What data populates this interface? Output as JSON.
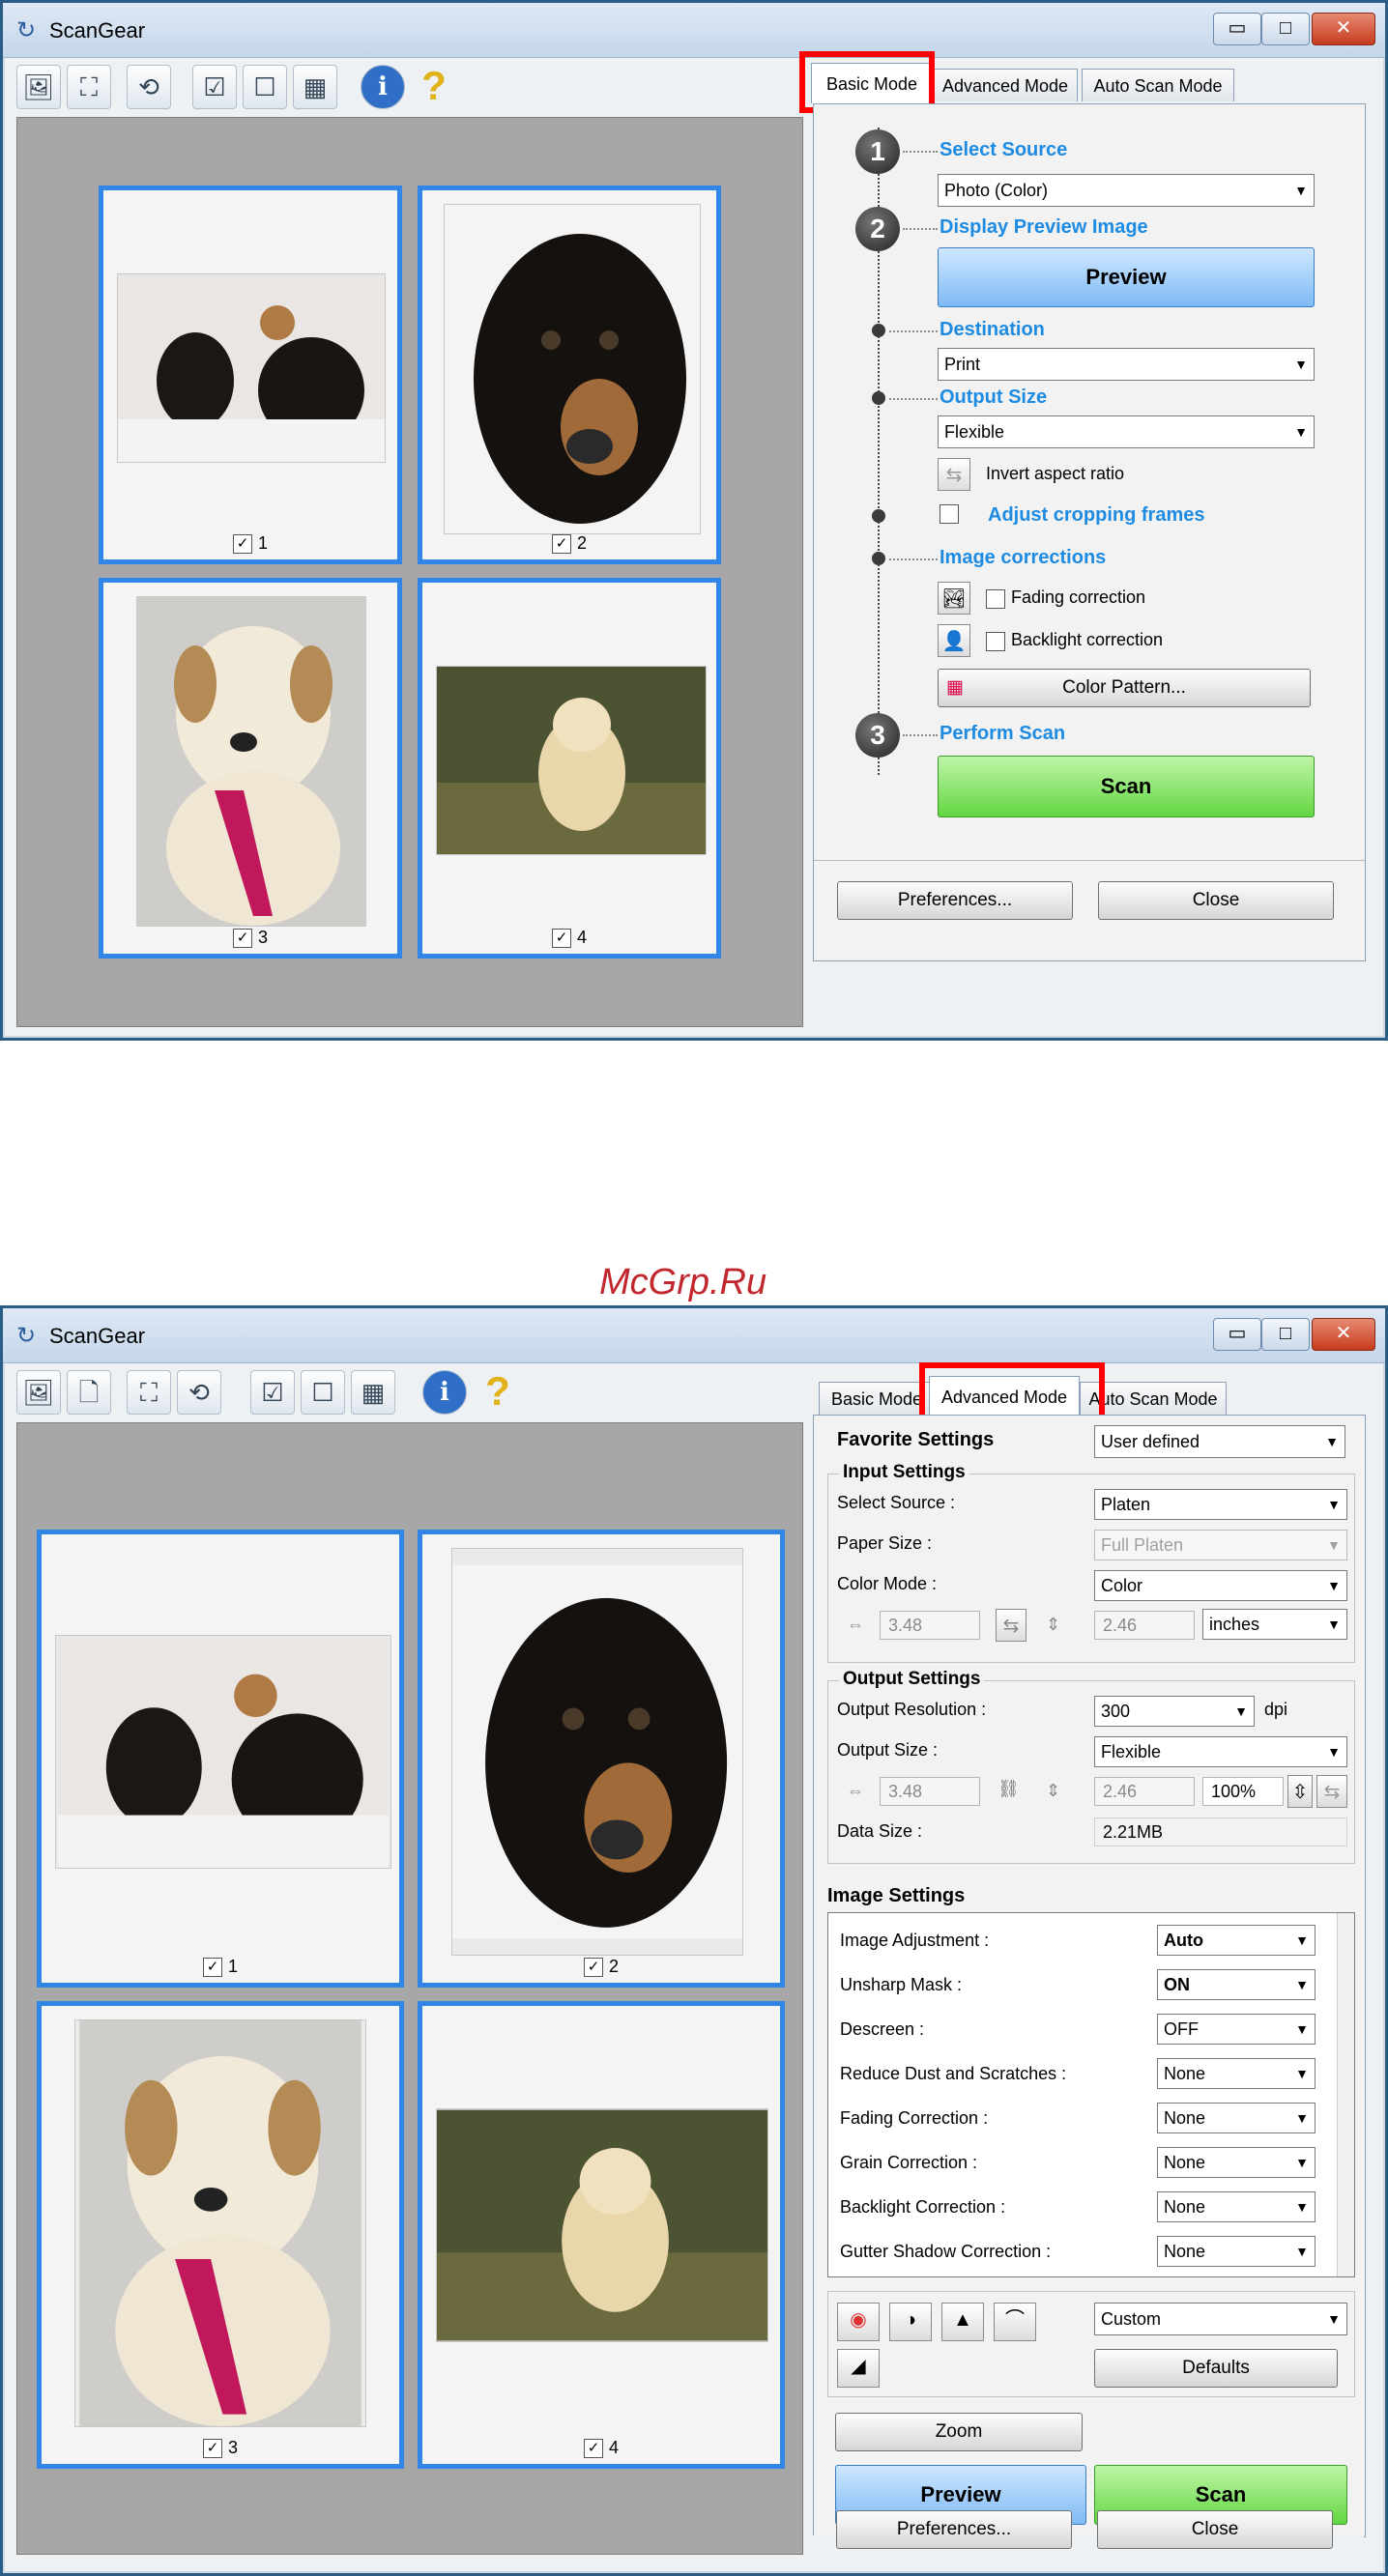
{
  "watermark": "McGrp.Ru",
  "window_title": "ScanGear",
  "window_controls": {
    "minimize": "▭",
    "maximize": "□",
    "close": "✕"
  },
  "toolbar_glyphs": {
    "info": "i",
    "help": "?"
  },
  "thumbnails": [
    {
      "number": "1",
      "checked": "✓"
    },
    {
      "number": "2",
      "checked": "✓"
    },
    {
      "number": "3",
      "checked": "✓"
    },
    {
      "number": "4",
      "checked": "✓"
    }
  ],
  "tabs": {
    "basic": "Basic Mode",
    "advanced": "Advanced Mode",
    "auto": "Auto Scan Mode"
  },
  "basic": {
    "steps": [
      "1",
      "2",
      "3"
    ],
    "select_source_label": "Select Source",
    "select_source_value": "Photo (Color)",
    "display_preview_label": "Display Preview Image",
    "preview_button": "Preview",
    "destination_label": "Destination",
    "destination_value": "Print",
    "output_size_label": "Output Size",
    "output_size_value": "Flexible",
    "invert_aspect_ratio": "Invert aspect ratio",
    "adjust_cropping": "Adjust cropping frames",
    "image_corrections_label": "Image corrections",
    "fading_correction": "Fading correction",
    "backlight_correction": "Backlight correction",
    "color_pattern_button": "Color Pattern...",
    "perform_scan_label": "Perform Scan",
    "scan_button": "Scan"
  },
  "advanced": {
    "favorite_settings_label": "Favorite Settings",
    "favorite_settings_value": "User defined",
    "input_settings_title": "Input Settings",
    "select_source_label": "Select Source :",
    "select_source_value": "Platen",
    "paper_size_label": "Paper Size :",
    "paper_size_value": "Full Platen",
    "color_mode_label": "Color Mode :",
    "color_mode_value": "Color",
    "input_width": "3.48",
    "input_height": "2.46",
    "units_value": "inches",
    "output_settings_title": "Output Settings",
    "output_resolution_label": "Output Resolution :",
    "output_resolution_value": "300",
    "dpi_label": "dpi",
    "output_size_label": "Output Size :",
    "output_size_value": "Flexible",
    "output_width": "3.48",
    "output_height": "2.46",
    "scale_value": "100%",
    "data_size_label": "Data Size :",
    "data_size_value": "2.21MB",
    "image_settings_title": "Image Settings",
    "image_settings": [
      {
        "label": "Image Adjustment :",
        "value": "Auto"
      },
      {
        "label": "Unsharp Mask :",
        "value": "ON"
      },
      {
        "label": "Descreen :",
        "value": "OFF"
      },
      {
        "label": "Reduce Dust and Scratches :",
        "value": "None"
      },
      {
        "label": "Fading Correction :",
        "value": "None"
      },
      {
        "label": "Grain Correction :",
        "value": "None"
      },
      {
        "label": "Backlight Correction :",
        "value": "None"
      },
      {
        "label": "Gutter Shadow Correction :",
        "value": "None"
      }
    ],
    "tone_preset_value": "Custom",
    "defaults_button": "Defaults",
    "zoom_button": "Zoom",
    "preview_button": "Preview",
    "scan_button": "Scan"
  },
  "footer": {
    "preferences_button": "Preferences...",
    "close_button": "Close"
  },
  "colors": {
    "accent_blue": "#1e8be3",
    "thumb_border": "#2f86e6",
    "highlight_red": "#ff0000",
    "scan_green": "#63d642",
    "preview_blue": "#7fbaf5"
  },
  "icons": [
    "scanner-icon",
    "crop-icon",
    "select-all-icon",
    "info-icon",
    "help-icon",
    "dropdown-arrow-icon",
    "checkbox-icon",
    "link-icon",
    "color-pattern-icon"
  ]
}
